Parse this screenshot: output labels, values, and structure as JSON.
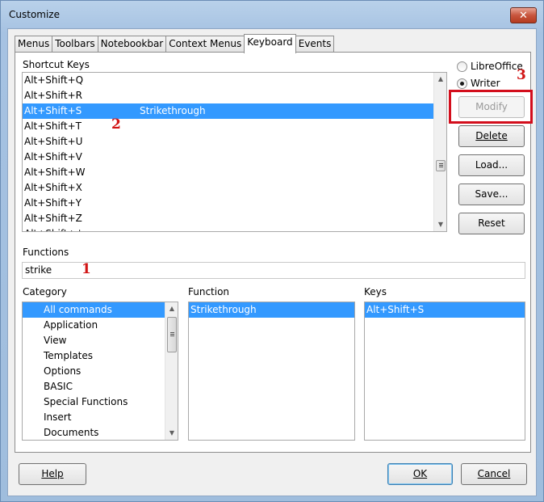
{
  "window": {
    "title": "Customize",
    "close_glyph": "✕"
  },
  "tabs": [
    {
      "label": "Menus",
      "active": false
    },
    {
      "label": "Toolbars",
      "active": false
    },
    {
      "label": "Notebookbar",
      "active": false
    },
    {
      "label": "Context Menus",
      "active": false
    },
    {
      "label": "Keyboard",
      "active": true
    },
    {
      "label": "Events",
      "active": false
    }
  ],
  "shortcut_keys": {
    "label": "Shortcut Keys",
    "rows": [
      {
        "key": "Alt+Shift+Q",
        "command": "",
        "selected": false
      },
      {
        "key": "Alt+Shift+R",
        "command": "",
        "selected": false
      },
      {
        "key": "Alt+Shift+S",
        "command": "Strikethrough",
        "selected": true
      },
      {
        "key": "Alt+Shift+T",
        "command": "",
        "selected": false
      },
      {
        "key": "Alt+Shift+U",
        "command": "",
        "selected": false
      },
      {
        "key": "Alt+Shift+V",
        "command": "",
        "selected": false
      },
      {
        "key": "Alt+Shift+W",
        "command": "",
        "selected": false
      },
      {
        "key": "Alt+Shift+X",
        "command": "",
        "selected": false
      },
      {
        "key": "Alt+Shift+Y",
        "command": "",
        "selected": false
      },
      {
        "key": "Alt+Shift+Z",
        "command": "",
        "selected": false
      },
      {
        "key": "Alt+Shift+↓",
        "command": "",
        "selected": false
      }
    ]
  },
  "scope": {
    "libreoffice": {
      "label": "LibreOffice",
      "selected": false
    },
    "writer": {
      "label": "Writer",
      "selected": true
    }
  },
  "side_buttons": {
    "modify": "Modify",
    "delete": "Delete",
    "load": "Load...",
    "save": "Save...",
    "reset": "Reset"
  },
  "functions": {
    "label": "Functions",
    "search_value": "strike"
  },
  "category": {
    "label": "Category",
    "items": [
      "All commands",
      "Application",
      "View",
      "Templates",
      "Options",
      "BASIC",
      "Special Functions",
      "Insert",
      "Documents"
    ]
  },
  "function": {
    "label": "Function",
    "items": [
      "Strikethrough"
    ]
  },
  "keys": {
    "label": "Keys",
    "items": [
      "Alt+Shift+S"
    ]
  },
  "footer": {
    "help": "Help",
    "ok": "OK",
    "cancel": "Cancel"
  },
  "annotations": {
    "one": "1",
    "two": "2",
    "three": "3"
  },
  "colors": {
    "selection": "#3399ff",
    "annotation": "#d11414"
  }
}
